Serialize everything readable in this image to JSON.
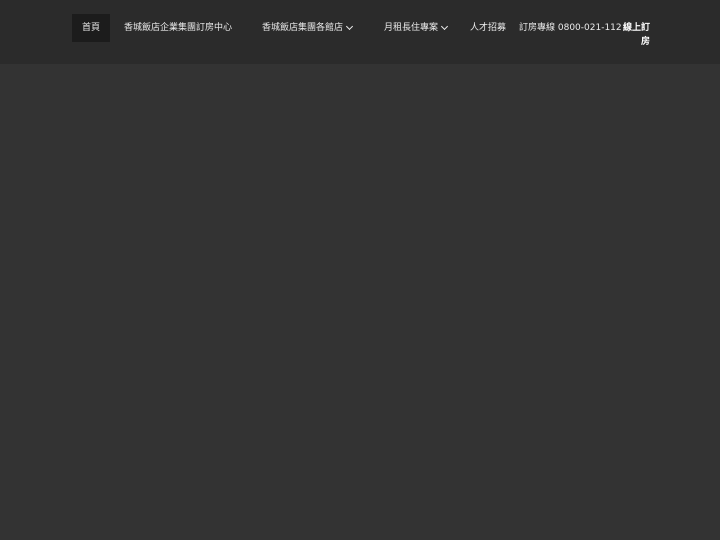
{
  "nav": {
    "home": "首頁",
    "corporate_booking": "香城飯店企業集團訂房中心",
    "branches": "香城飯店集團各館店",
    "monthly_rental": "月租長住專案",
    "recruit": "人才招募",
    "hotline": "訂房專線 0800-021-112",
    "online_booking": "線上訂房"
  },
  "icons": {
    "branches_dropdown": "chevron-down-icon",
    "monthly_dropdown": "chevron-down-icon"
  },
  "colors": {
    "header_bg": "#2b2b2b",
    "page_bg": "#333333",
    "active_bg": "#1c1c1c",
    "text": "#ececec"
  }
}
